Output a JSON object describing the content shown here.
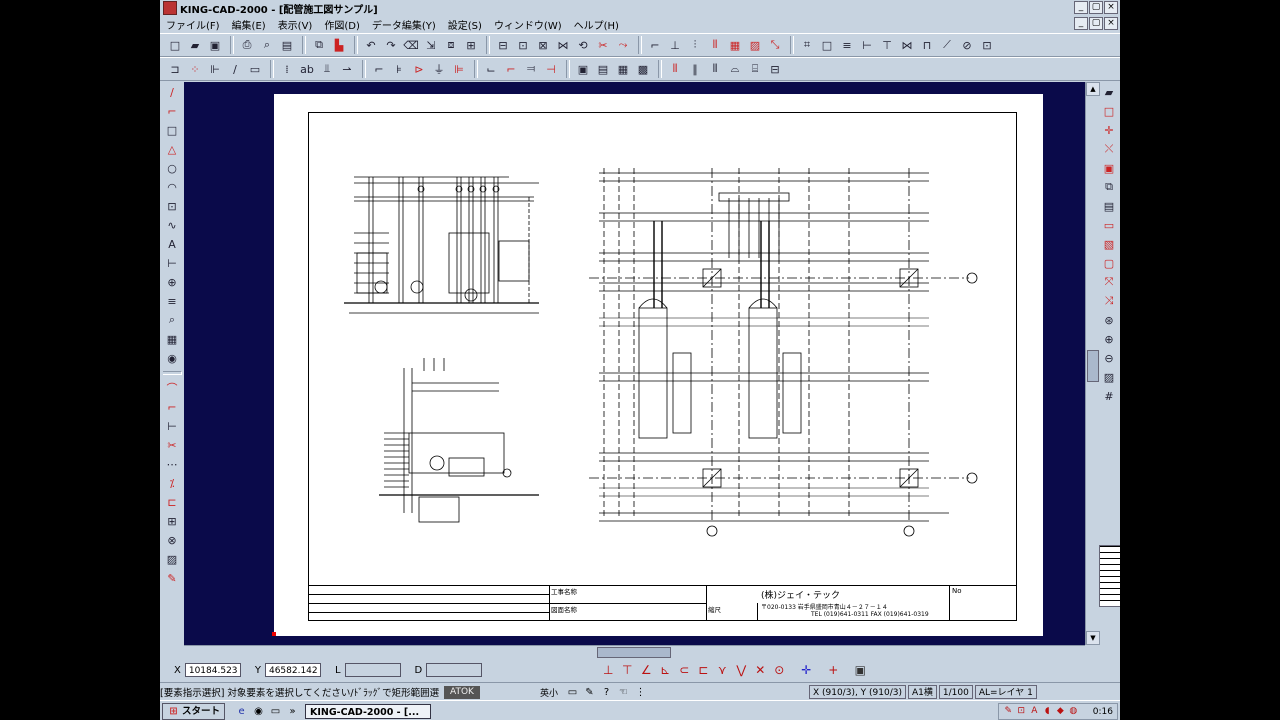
{
  "window": {
    "title": "KING-CAD-2000 - [配管施工図サンプル]",
    "min_label": "_",
    "restore_label": "▢",
    "close_label": "×"
  },
  "menu": {
    "items": [
      "ファイル(F)",
      "編集(E)",
      "表示(V)",
      "作図(D)",
      "データ編集(Y)",
      "設定(S)",
      "ウィンドウ(W)",
      "ヘルプ(H)"
    ]
  },
  "title_block": {
    "project_label": "工事名称",
    "drawing_label": "図面名称",
    "scale_label": "縮尺",
    "company": "(株)ジェイ・テック",
    "address": "〒020-0133  岩手県盛岡市青山４－２７－１４",
    "phone": "TEL (019)641-0311  FAX (019)641-0319",
    "no_label": "No"
  },
  "coords": {
    "x_label": "X",
    "x_value": "10184.523",
    "y_label": "Y",
    "y_value": "46582.142",
    "l_label": "L",
    "l_value": "",
    "d_label": "D",
    "d_value": ""
  },
  "status": {
    "message": "[要素指示選択] 対象要素を選択してください/ﾄﾞﾗｯｸﾞで矩形範囲選",
    "atok": "ATOK",
    "key_mode": "英小",
    "grid": "X (910/3), Y (910/3)",
    "paper": "A1横",
    "scale": "1/100",
    "layer": "AL=レイヤ 1"
  },
  "taskbar": {
    "start_label": "スタート",
    "task_label": "KING-CAD-2000 - [...",
    "clock": "0:16"
  },
  "icons": {
    "toolbar1": [
      "new-file-icon",
      "open-folder-icon",
      "save-icon",
      "print-icon",
      "print-preview-icon",
      "layout-icon",
      "copy-icon",
      "paste-icon",
      "undo-icon",
      "redo-icon",
      "erase-icon"
    ],
    "left": [
      "line-icon",
      "polyline-icon",
      "rectangle-icon",
      "triangle-icon",
      "circle-icon",
      "arc-icon",
      "square-icon",
      "curve-icon",
      "text-icon",
      "dimension-icon",
      "symbol-icon",
      "hatch-icon",
      "zoom-icon",
      "grid-icon",
      "snap-icon"
    ]
  },
  "colors": {
    "canvas_bg": "#0a0a4a",
    "chrome_bg": "#c7d3e0",
    "snap_red": "#bb1111"
  }
}
